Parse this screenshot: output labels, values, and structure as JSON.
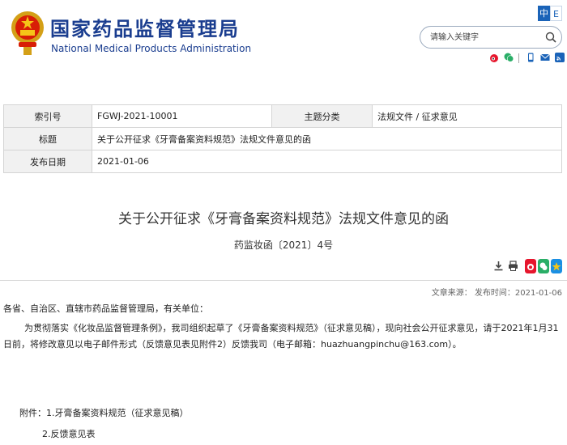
{
  "header": {
    "site_name_cn": "国家药品监督管理局",
    "site_name_en": "National Medical Products Administration",
    "lang_zh": "中",
    "lang_en": "E",
    "search_placeholder": "请输入关键字",
    "social_icons": [
      "weibo-icon",
      "wechat-icon",
      "mobile-icon",
      "email-icon",
      "rss-icon"
    ],
    "brand_color": "#1a3d8f"
  },
  "meta": {
    "index_label": "索引号",
    "index_value": "FGWJ-2021-10001",
    "topic_label": "主题分类",
    "topic_value": "法规文件 / 征求意见",
    "title_label": "标题",
    "title_value": "关于公开征求《牙膏备案资料规范》法规文件意见的函",
    "date_label": "发布日期",
    "date_value": "2021-01-06"
  },
  "article": {
    "title": "关于公开征求《牙膏备案资料规范》法规文件意见的函",
    "doc_number": "药监妆函〔2021〕4号",
    "publish_time": "文章来源：  发布时间：2021-01-06",
    "greeting": "各省、自治区、直辖市药品监督管理局，有关单位：",
    "paragraph": "为贯彻落实《化妆品监督管理条例》，我司组织起草了《牙膏备案资料规范》（征求意见稿），现向社会公开征求意见，请于2021年1月31日前，将修改意见以电子邮件形式（反馈意见表见附件2）反馈我司（电子邮箱：huazhuangpinchu@163.com）。",
    "attachment_1": "附件：1.牙膏备案资料规范（征求意见稿）",
    "attachment_2": "2.反馈意见表"
  }
}
